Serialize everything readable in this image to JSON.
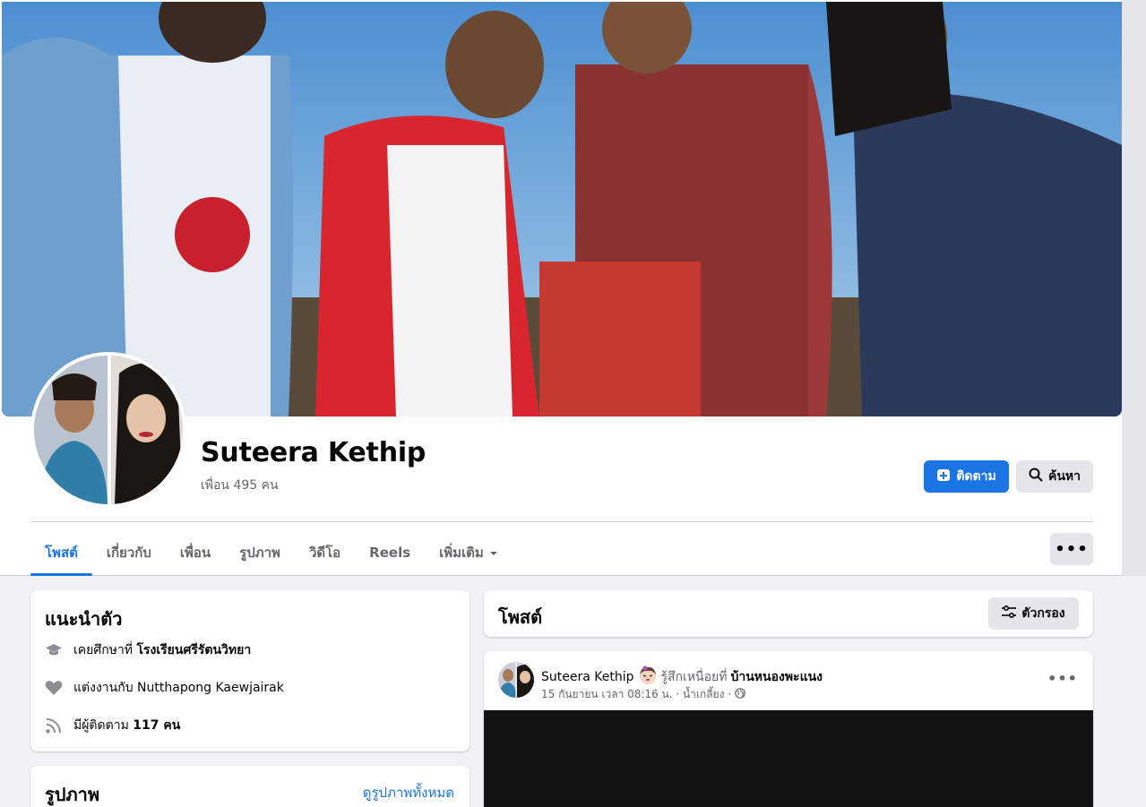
{
  "profile": {
    "name": "Suteera Kethip",
    "friends": "เพื่อน 495 คน"
  },
  "actions": {
    "follow_label": "ติดตาม",
    "search_label": "ค้นหา",
    "more_label": "•••"
  },
  "tabs": [
    {
      "label": "โพสต์",
      "active": true
    },
    {
      "label": "เกี่ยวกับ"
    },
    {
      "label": "เพื่อน"
    },
    {
      "label": "รูปภาพ"
    },
    {
      "label": "วิดีโอ"
    },
    {
      "label": "Reels"
    },
    {
      "label": "เพิ่มเติม",
      "chevron": "chevron-down-icon"
    }
  ],
  "intro": {
    "title": "แนะนำตัว",
    "items": [
      {
        "icon": "education-icon",
        "prefix": "เคยศึกษาที่ ",
        "value": "โรงเรียนศรีรัตนวิทยา"
      },
      {
        "icon": "heart-icon",
        "prefix": "แต่งงานกับ ",
        "value": "Nutthapong Kaewjairak"
      },
      {
        "icon": "rss-icon",
        "prefix": "มีผู้ติดตาม ",
        "value": "117 คน"
      }
    ]
  },
  "photos": {
    "title": "รูปภาพ",
    "link": "ดูรูปภาพทั้งหมด"
  },
  "posts": {
    "title": "โพสต์",
    "filter_label": "ตัวกรอง"
  },
  "post": {
    "author": "Suteera Kethip",
    "feeling": "รู้สึกเหนื่อยที่",
    "place": "บ้านหนองพะแนง",
    "timestamp": "15 กันยายน เวลา 08:16 น. · น้ำเกลี้ยง ·",
    "more_label": "•••"
  },
  "colors": {
    "accent": "#1b74e4",
    "background": "#f0f2f5",
    "secondary_button": "#e4e6eb",
    "muted_text": "#65676b"
  }
}
